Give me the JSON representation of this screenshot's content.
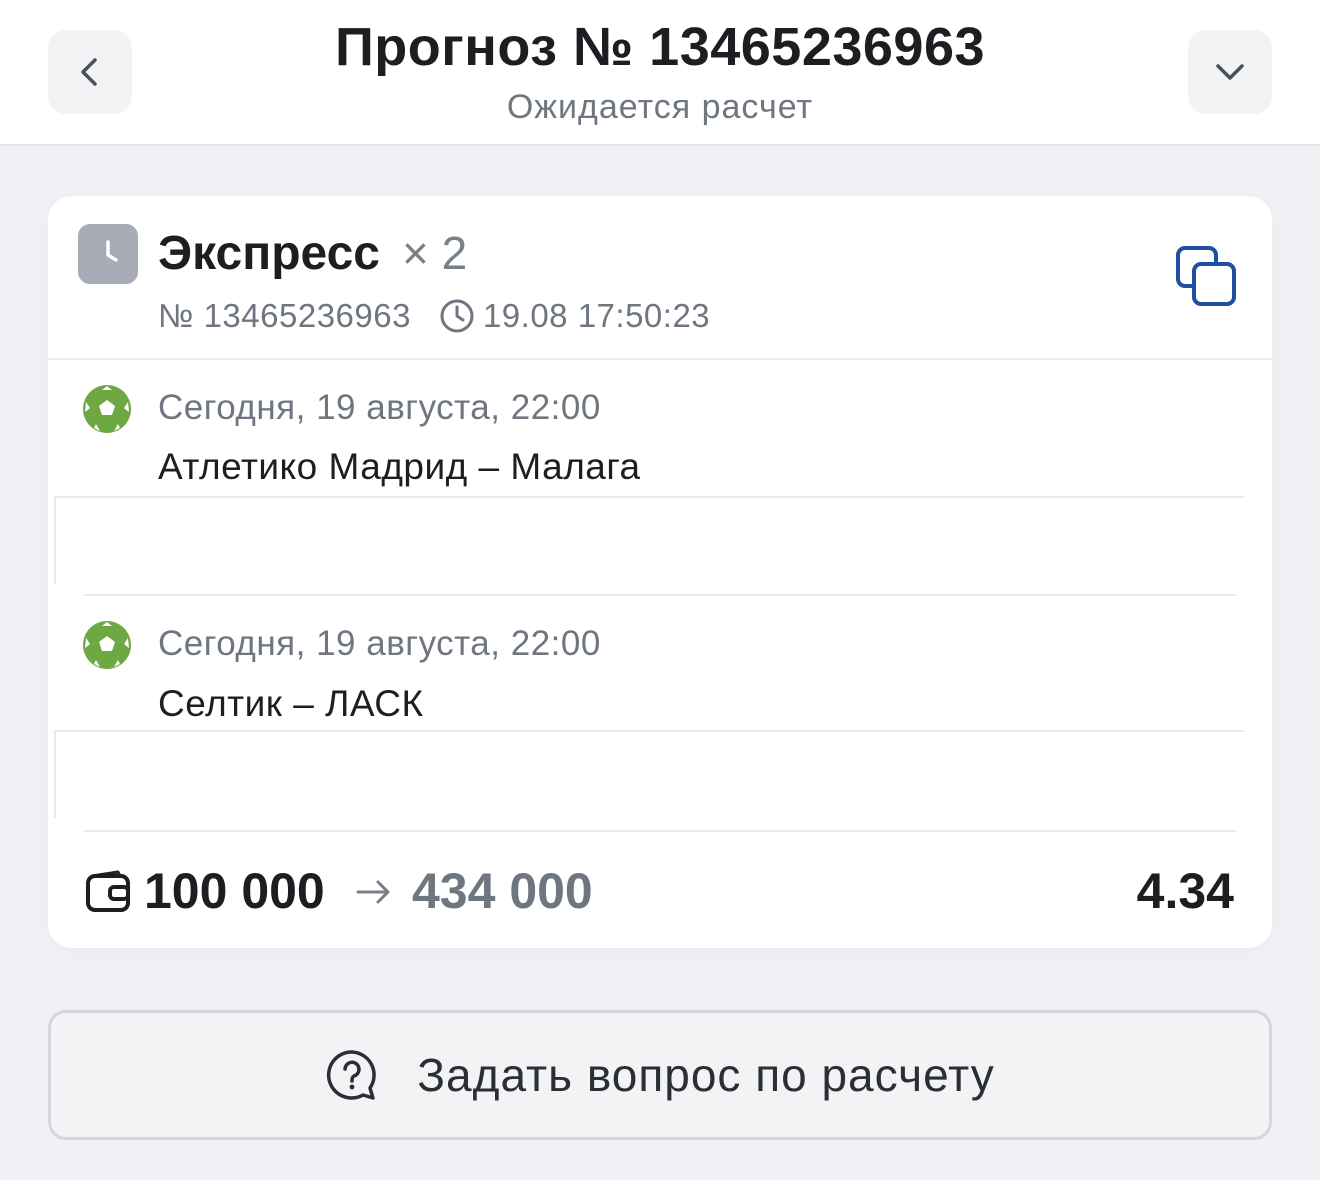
{
  "header": {
    "title": "Прогноз № 13465236963",
    "subtitle": "Ожидается расчет",
    "back_icon": "chevron-left-icon",
    "more_icon": "chevron-down-icon"
  },
  "bet": {
    "type_icon": "clock-icon",
    "type": "Экспресс",
    "multiplier": "× 2",
    "number": "№ 13465236963",
    "time": "19.08 17:50:23",
    "copy_icon": "copy-icon",
    "events": [
      {
        "sport_icon": "football-icon",
        "date": "Сегодня, 19 августа, 22:00",
        "name": "Атлетико Мадрид – Малага"
      },
      {
        "sport_icon": "football-icon",
        "date": "Сегодня, 19 августа, 22:00",
        "name": "Селтик – ЛАСК"
      }
    ],
    "stake": "100 000",
    "payout": "434 000",
    "odds": "4.34"
  },
  "ask_button": {
    "label": "Задать вопрос по расчету",
    "icon": "question-bubble-icon"
  },
  "colors": {
    "background": "#eff1f4",
    "card": "#ffffff",
    "accent_blue": "#1e4fa0",
    "football_green": "#6ea843",
    "muted_text": "#6f7680"
  }
}
